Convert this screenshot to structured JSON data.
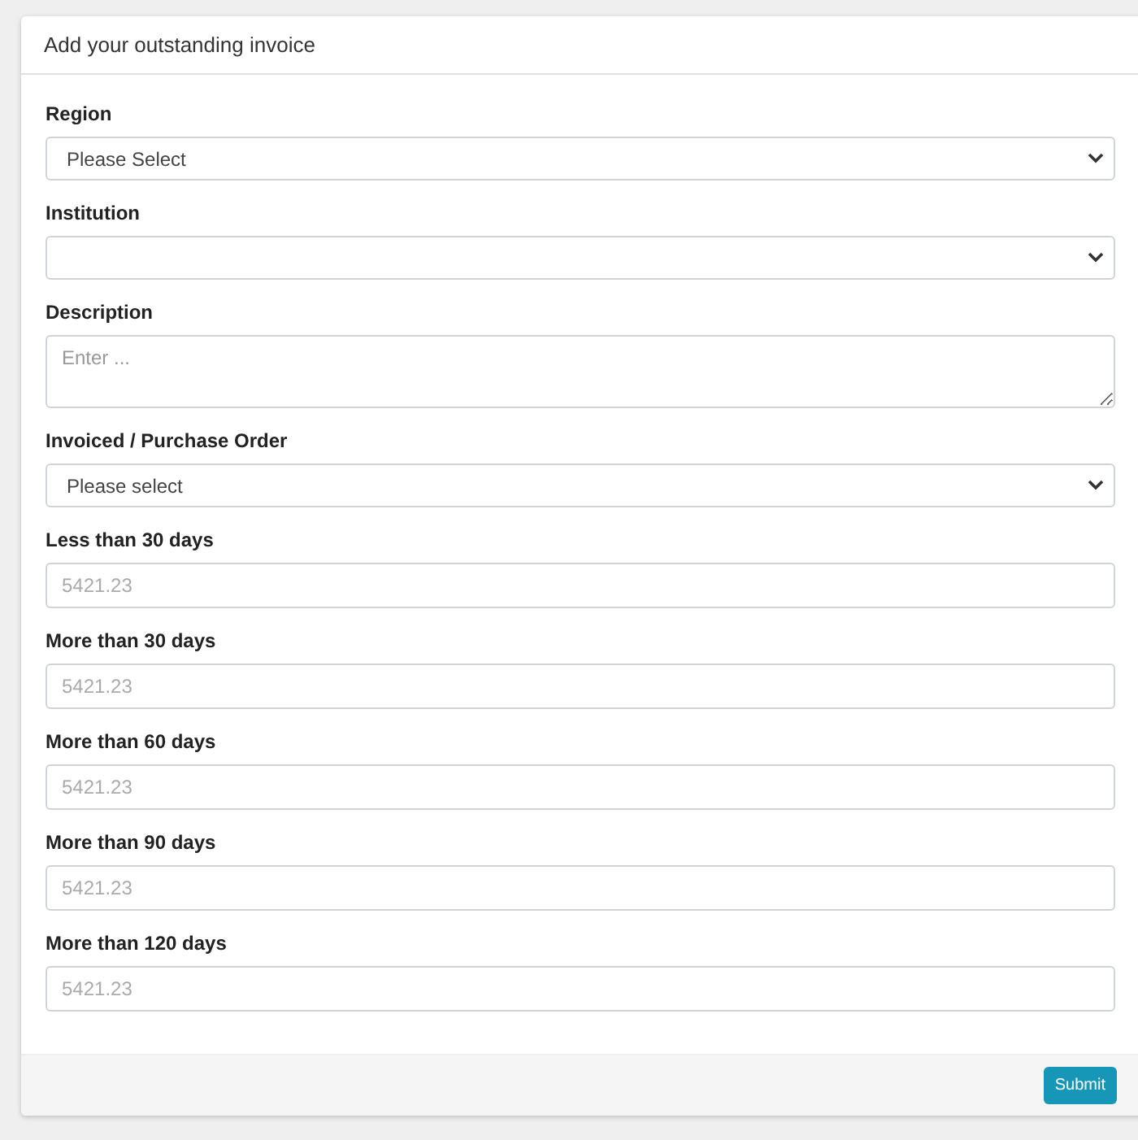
{
  "modal": {
    "title": "Add your outstanding invoice"
  },
  "fields": [
    {
      "kind": "select",
      "label": "Region",
      "value": "Please Select"
    },
    {
      "kind": "select",
      "label": "Institution"
    },
    {
      "kind": "textarea",
      "label": "Description",
      "placeholder": "Enter ..."
    },
    {
      "kind": "select",
      "label": "Invoiced / Purchase Order",
      "value": "Please select"
    },
    {
      "kind": "input",
      "label": "Less than 30 days",
      "placeholder": "5421.23"
    },
    {
      "kind": "input",
      "label": "More than 30 days",
      "placeholder": "5421.23"
    },
    {
      "kind": "input",
      "label": "More than 60 days",
      "placeholder": "5421.23"
    },
    {
      "kind": "input",
      "label": "More than 90 days",
      "placeholder": "5421.23"
    },
    {
      "kind": "input",
      "label": "More than 120 days",
      "placeholder": "5421.23"
    }
  ],
  "buttons": [
    {
      "label": "Submit"
    }
  ]
}
